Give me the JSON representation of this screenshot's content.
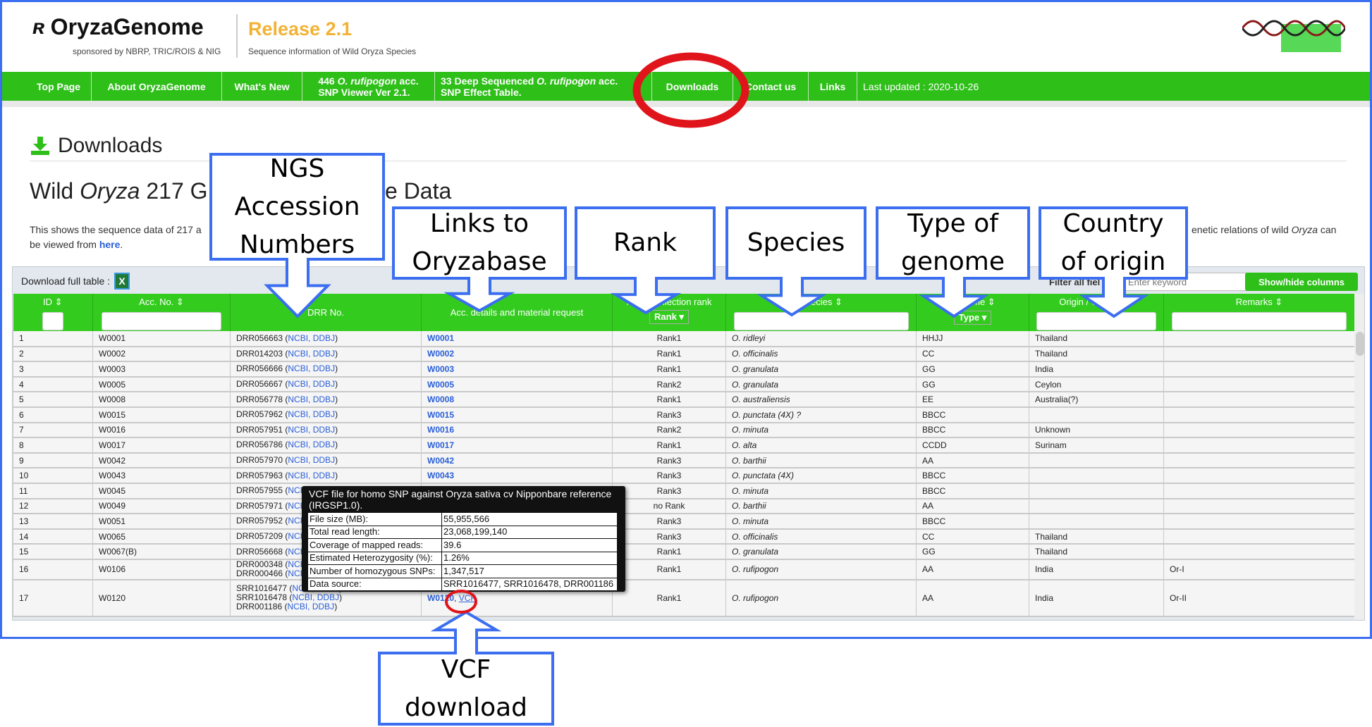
{
  "header": {
    "logo": "OryzaGenome",
    "sponsor": "sponsored by NBRP, TRIC/ROIS & NIG",
    "release": "Release 2.1",
    "subtitle": "Sequence information of Wild Oryza Species"
  },
  "nav": {
    "items": [
      {
        "label": "Top Page"
      },
      {
        "label": "About OryzaGenome"
      },
      {
        "label": "What's New"
      },
      {
        "line1a": "446 ",
        "line1i": "O. rufipogon",
        "line1b": " acc.",
        "line2": "SNP Viewer Ver 2.1."
      },
      {
        "line1a": "33 Deep Sequenced ",
        "line1i": "O. rufipogon",
        "line1b": " acc.",
        "line2": "SNP Effect Table."
      },
      {
        "label": "Downloads"
      },
      {
        "label": "Contact us"
      },
      {
        "label": "Links"
      }
    ],
    "last_updated": "Last updated : 2020-10-26"
  },
  "page": {
    "heading": "Downloads",
    "title_a": "Wild ",
    "title_i": "Oryza",
    "title_b": " 217 G",
    "title_end": "e Data",
    "desc1": "This shows the sequence data of 217 a",
    "desc2a": "enetic relations of wild ",
    "desc2i": "Oryza",
    "desc2b": " can",
    "desc3a": "be viewed from ",
    "desc3_link": "here",
    "desc3b": "."
  },
  "toolbar": {
    "download_label": "Download full table :",
    "excel_icon": "X",
    "filter_label": "Filter all fiel",
    "filter_placeholder": "Enter keyword",
    "showhide_label": "Show/hide columns"
  },
  "table": {
    "headers": {
      "id": "ID ⇕",
      "acc": "Acc. No. ⇕",
      "drr": "DRR No.",
      "details": "Acc. details and material request",
      "rank_top": "NIG  a collection rank",
      "rank_select": "Rank ▾",
      "species": "Species ⇕",
      "genome_top": "Genome ⇕",
      "genome_select": "Type ▾",
      "origin": "Origin / Country ⇕",
      "remarks": "Remarks ⇕"
    },
    "link_suffix": "NCBI, DDBJ",
    "rows": [
      {
        "id": "1",
        "acc": "W0001",
        "drr": [
          "DRR056663"
        ],
        "details": "W0001",
        "rank": "Rank1",
        "species": "O. ridleyi",
        "genome": "HHJJ",
        "origin": "Thailand",
        "remarks": ""
      },
      {
        "id": "2",
        "acc": "W0002",
        "drr": [
          "DRR014203"
        ],
        "details": "W0002",
        "rank": "Rank1",
        "species": "O. officinalis",
        "genome": "CC",
        "origin": "Thailand",
        "remarks": ""
      },
      {
        "id": "3",
        "acc": "W0003",
        "drr": [
          "DRR056666"
        ],
        "details": "W0003",
        "rank": "Rank1",
        "species": "O. granulata",
        "genome": "GG",
        "origin": "India",
        "remarks": ""
      },
      {
        "id": "4",
        "acc": "W0005",
        "drr": [
          "DRR056667"
        ],
        "details": "W0005",
        "rank": "Rank2",
        "species": "O. granulata",
        "genome": "GG",
        "origin": "Ceylon",
        "remarks": ""
      },
      {
        "id": "5",
        "acc": "W0008",
        "drr": [
          "DRR056778"
        ],
        "details": "W0008",
        "rank": "Rank1",
        "species": "O. australiensis",
        "genome": "EE",
        "origin": "Australia(?)",
        "remarks": ""
      },
      {
        "id": "6",
        "acc": "W0015",
        "drr": [
          "DRR057962"
        ],
        "details": "W0015",
        "rank": "Rank3",
        "species": "O. punctata (4X) ?",
        "genome": "BBCC",
        "origin": "",
        "remarks": ""
      },
      {
        "id": "7",
        "acc": "W0016",
        "drr": [
          "DRR057951"
        ],
        "details": "W0016",
        "rank": "Rank2",
        "species": "O. minuta",
        "genome": "BBCC",
        "origin": "Unknown",
        "remarks": ""
      },
      {
        "id": "8",
        "acc": "W0017",
        "drr": [
          "DRR056786"
        ],
        "details": "W0017",
        "rank": "Rank1",
        "species": "O. alta",
        "genome": "CCDD",
        "origin": "Surinam",
        "remarks": ""
      },
      {
        "id": "9",
        "acc": "W0042",
        "drr": [
          "DRR057970"
        ],
        "details": "W0042",
        "rank": "Rank3",
        "species": "O. barthii",
        "genome": "AA",
        "origin": "",
        "remarks": ""
      },
      {
        "id": "10",
        "acc": "W0043",
        "drr": [
          "DRR057963"
        ],
        "details": "W0043",
        "rank": "Rank3",
        "species": "O. punctata (4X)",
        "genome": "BBCC",
        "origin": "",
        "remarks": ""
      },
      {
        "id": "11",
        "acc": "W0045",
        "drr": [
          "DRR057955"
        ],
        "details": "",
        "rank": "Rank3",
        "species": "O. minuta",
        "genome": "BBCC",
        "origin": "",
        "remarks": ""
      },
      {
        "id": "12",
        "acc": "W0049",
        "drr": [
          "DRR057971"
        ],
        "details": "",
        "rank": "no Rank",
        "species": "O. barthii",
        "genome": "AA",
        "origin": "",
        "remarks": ""
      },
      {
        "id": "13",
        "acc": "W0051",
        "drr": [
          "DRR057952"
        ],
        "details": "",
        "rank": "Rank3",
        "species": "O. minuta",
        "genome": "BBCC",
        "origin": "",
        "remarks": ""
      },
      {
        "id": "14",
        "acc": "W0065",
        "drr": [
          "DRR057209"
        ],
        "details": "",
        "rank": "Rank3",
        "species": "O. officinalis",
        "genome": "CC",
        "origin": "Thailand",
        "remarks": ""
      },
      {
        "id": "15",
        "acc": "W0067(B)",
        "drr": [
          "DRR056668"
        ],
        "details": "",
        "rank": "Rank1",
        "species": "O. granulata",
        "genome": "GG",
        "origin": "Thailand",
        "remarks": ""
      },
      {
        "id": "16",
        "acc": "W0106",
        "drr": [
          "DRR000348",
          "DRR000466"
        ],
        "details": "",
        "rank": "Rank1",
        "species": "O. rufipogon",
        "genome": "AA",
        "origin": "India",
        "remarks": "Or-I"
      },
      {
        "id": "17",
        "acc": "W0120",
        "drr": [
          "SRR1016477",
          "SRR1016478",
          "DRR001186"
        ],
        "details": "W0120",
        "vcf": "VCF",
        "rank": "Rank1",
        "species": "O. rufipogon",
        "genome": "AA",
        "origin": "India",
        "remarks": "Or-II"
      }
    ]
  },
  "tooltip": {
    "title": "VCF file for homo SNP against Oryza sativa cv Nipponbare reference (IRGSP1.0).",
    "rows": [
      {
        "k": "File size (MB):",
        "v": "55,955,566"
      },
      {
        "k": "Total read length:",
        "v": "23,068,199,140"
      },
      {
        "k": "Coverage of mapped reads:",
        "v": "39.6"
      },
      {
        "k": "Estimated Heterozygosity (%):",
        "v": "1.26%"
      },
      {
        "k": "Number of homozygous SNPs:",
        "v": "1,347,517"
      },
      {
        "k": "Data source:",
        "v": "SRR1016477, SRR1016478, DRR001186"
      }
    ]
  },
  "callouts": [
    {
      "line1": "NGS",
      "line2": "Accession",
      "line3": "Numbers"
    },
    {
      "line1": "Links to",
      "line2": "Oryzabase"
    },
    {
      "line1": "Rank"
    },
    {
      "line1": "Species"
    },
    {
      "line1": "Type of",
      "line2": "genome"
    },
    {
      "line1": "Country",
      "line2": "of origin"
    },
    {
      "line1": "VCF",
      "line2": "download"
    }
  ],
  "colors": {
    "nav_green": "#2ebf19",
    "callout_blue": "#3b6ef0",
    "highlight_red": "#e0141b",
    "release_orange": "#f2b234",
    "link_blue": "#2a5fd8"
  }
}
